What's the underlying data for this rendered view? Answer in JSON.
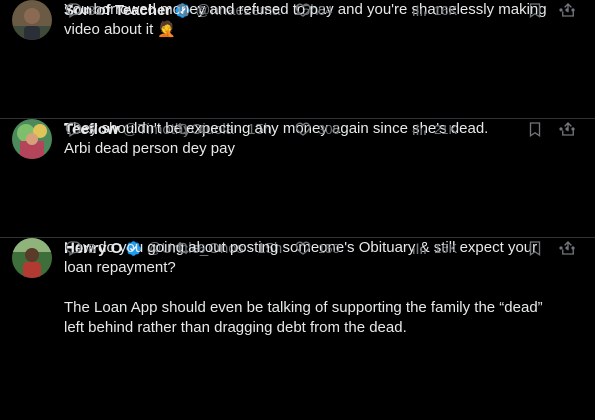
{
  "colors": {
    "background": "#000000",
    "text": "#e7e9ea",
    "muted": "#71767b",
    "verified": "#1d9bf0",
    "divider": "#2f3336"
  },
  "tweets": [
    {
      "name": "Son of Teacher",
      "handle": "@nnaezema",
      "dot": "·",
      "time": "15h",
      "lines": [
        "You borrowed money and refused to pay and you're shamelessly making",
        "video about it 🤦"
      ],
      "replies": "31",
      "retweets": "6",
      "likes": "64",
      "views": "16K"
    },
    {
      "name": "Teeflow",
      "handle": "@TimothyOjuola",
      "dot": "·",
      "time": "15h",
      "lines": [
        "They shouldn't be expecting any money again since she's dead.",
        "Arbi dead person dey pay"
      ],
      "replies": "5",
      "retweets": "4",
      "likes": "306",
      "views": "21K"
    },
    {
      "name": "Henry O",
      "handle": "@Uncle_Onos",
      "dot": "·",
      "time": "15h",
      "lines": [
        "How do you going about posting someone's Obituary & still expect your",
        "loan repayment?",
        "",
        "The Loan App should even be talking of supporting the family the “dead”",
        "left behind rather than dragging debt from the dead."
      ],
      "replies": "8",
      "retweets": "6",
      "likes": "150",
      "views": "16K"
    }
  ],
  "icons": [
    "verified-badge-icon",
    "more-options-icon",
    "reply-icon",
    "retweet-icon",
    "like-icon",
    "views-icon",
    "bookmark-icon",
    "share-icon"
  ]
}
